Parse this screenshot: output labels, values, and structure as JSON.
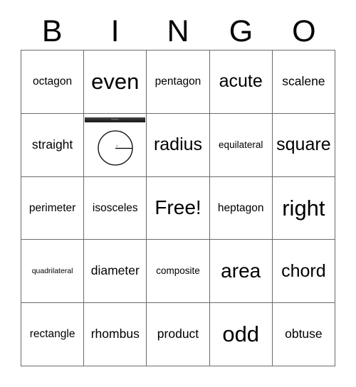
{
  "header": {
    "letters": [
      "B",
      "I",
      "N",
      "G",
      "O"
    ]
  },
  "grid": {
    "rows": 5,
    "columns": 5,
    "border_color": "#6b6b6b",
    "background": "#ffffff",
    "text_color": "#000000"
  },
  "cells": [
    {
      "text": "octagon",
      "type": "text"
    },
    {
      "text": "even",
      "type": "text"
    },
    {
      "text": "pentagon",
      "type": "text"
    },
    {
      "text": "acute",
      "type": "text"
    },
    {
      "text": "scalene",
      "type": "text"
    },
    {
      "text": "straight",
      "type": "text"
    },
    {
      "text": "",
      "type": "image",
      "image_name": "circle-radius-diagram",
      "image_label": "r",
      "toolbar_label": "Radius"
    },
    {
      "text": "radius",
      "type": "text"
    },
    {
      "text": "equilateral",
      "type": "text"
    },
    {
      "text": "square",
      "type": "text"
    },
    {
      "text": "perimeter",
      "type": "text"
    },
    {
      "text": "isosceles",
      "type": "text"
    },
    {
      "text": "Free!",
      "type": "text",
      "free_space": true
    },
    {
      "text": "heptagon",
      "type": "text"
    },
    {
      "text": "right",
      "type": "text"
    },
    {
      "text": "quadrilateral",
      "type": "text"
    },
    {
      "text": "diameter",
      "type": "text"
    },
    {
      "text": "composite",
      "type": "text"
    },
    {
      "text": "area",
      "type": "text"
    },
    {
      "text": "chord",
      "type": "text"
    },
    {
      "text": "rectangle",
      "type": "text"
    },
    {
      "text": "rhombus",
      "type": "text"
    },
    {
      "text": "product",
      "type": "text"
    },
    {
      "text": "odd",
      "type": "text"
    },
    {
      "text": "obtuse",
      "type": "text"
    }
  ]
}
